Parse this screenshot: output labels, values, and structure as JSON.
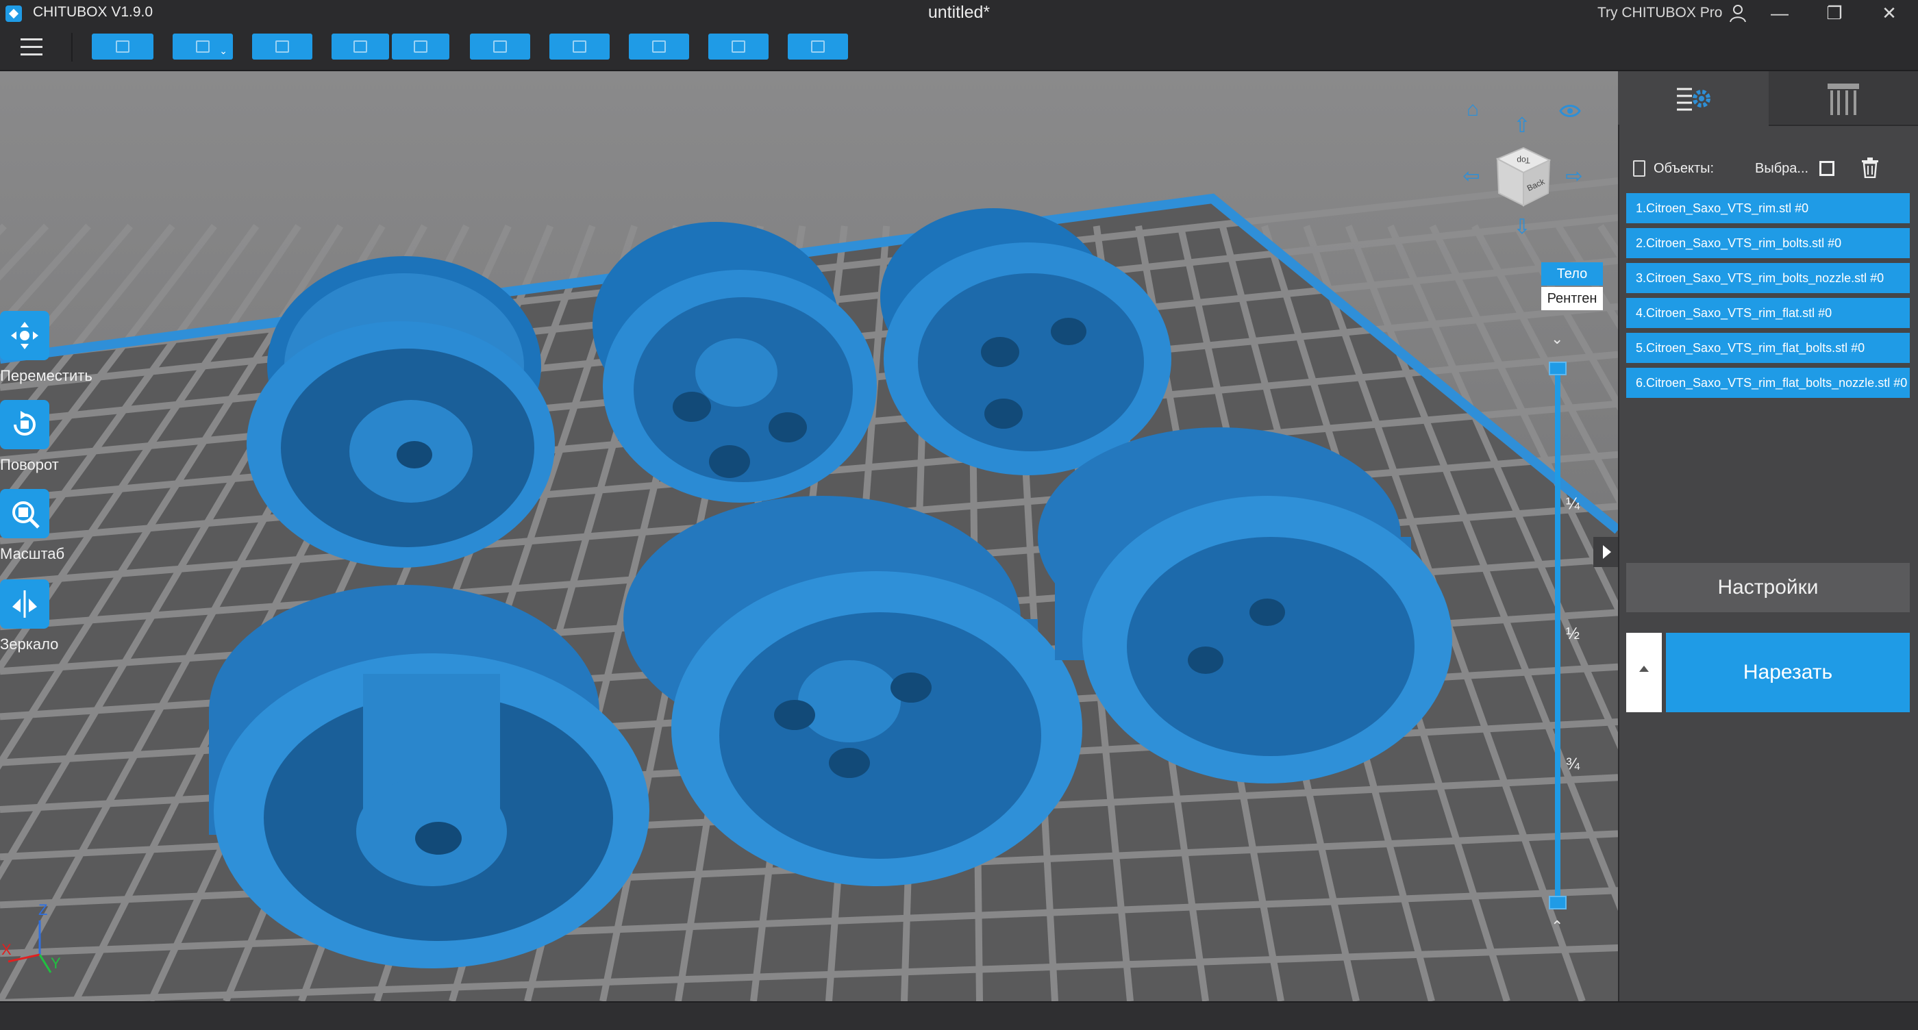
{
  "app": {
    "name": "CHITUBOX V1.9.0",
    "document_title": "untitled*",
    "try_pro": "Try CHITUBOX Pro"
  },
  "colors": {
    "accent": "#1f9be6",
    "viewport": "#7b7b7c",
    "panel": "#454547",
    "titlebar": "#2b2b2d"
  },
  "toolbar": {
    "buttons": [
      {
        "name": "open-file",
        "icon": "folder-icon"
      },
      {
        "name": "save",
        "icon": "save-icon",
        "dropdown": true
      },
      {
        "name": "import",
        "icon": "import-icon"
      },
      {
        "name": "undo",
        "icon": "undo-icon"
      },
      {
        "name": "redo",
        "icon": "redo-icon"
      },
      {
        "name": "layout",
        "icon": "layout-icon"
      },
      {
        "name": "arrange",
        "icon": "arrange-icon"
      },
      {
        "name": "hollow",
        "icon": "hollow-icon"
      },
      {
        "name": "holes",
        "icon": "holes-icon"
      },
      {
        "name": "ui-tools",
        "icon": "tools-icon"
      }
    ]
  },
  "left_tools": [
    {
      "label": "Переместить",
      "icon": "move-icon"
    },
    {
      "label": "Поворот",
      "icon": "rotate-icon"
    },
    {
      "label": "Масштаб",
      "icon": "scale-icon"
    },
    {
      "label": "Зеркало",
      "icon": "mirror-icon"
    }
  ],
  "view_cube": {
    "faces": {
      "top": "Top",
      "front": "Back"
    }
  },
  "render_mode": {
    "body": "Тело",
    "xray": "Рентген"
  },
  "slider": {
    "marks": [
      "¼",
      "½",
      "¾"
    ]
  },
  "axes": {
    "z": "Z",
    "x": "X",
    "y": "Y"
  },
  "right_panel": {
    "objects_label": "Объекты:",
    "select_label": "Выбра...",
    "objects": [
      "1.Citroen_Saxo_VTS_rim.stl #0",
      "2.Citroen_Saxo_VTS_rim_bolts.stl #0",
      "3.Citroen_Saxo_VTS_rim_bolts_nozzle.stl #0",
      "4.Citroen_Saxo_VTS_rim_flat.stl #0",
      "5.Citroen_Saxo_VTS_rim_flat_bolts.stl #0",
      "6.Citroen_Saxo_VTS_rim_flat_bolts_nozzle.stl #0"
    ],
    "settings_button": "Настройки",
    "slice_button": "Нарезать"
  }
}
